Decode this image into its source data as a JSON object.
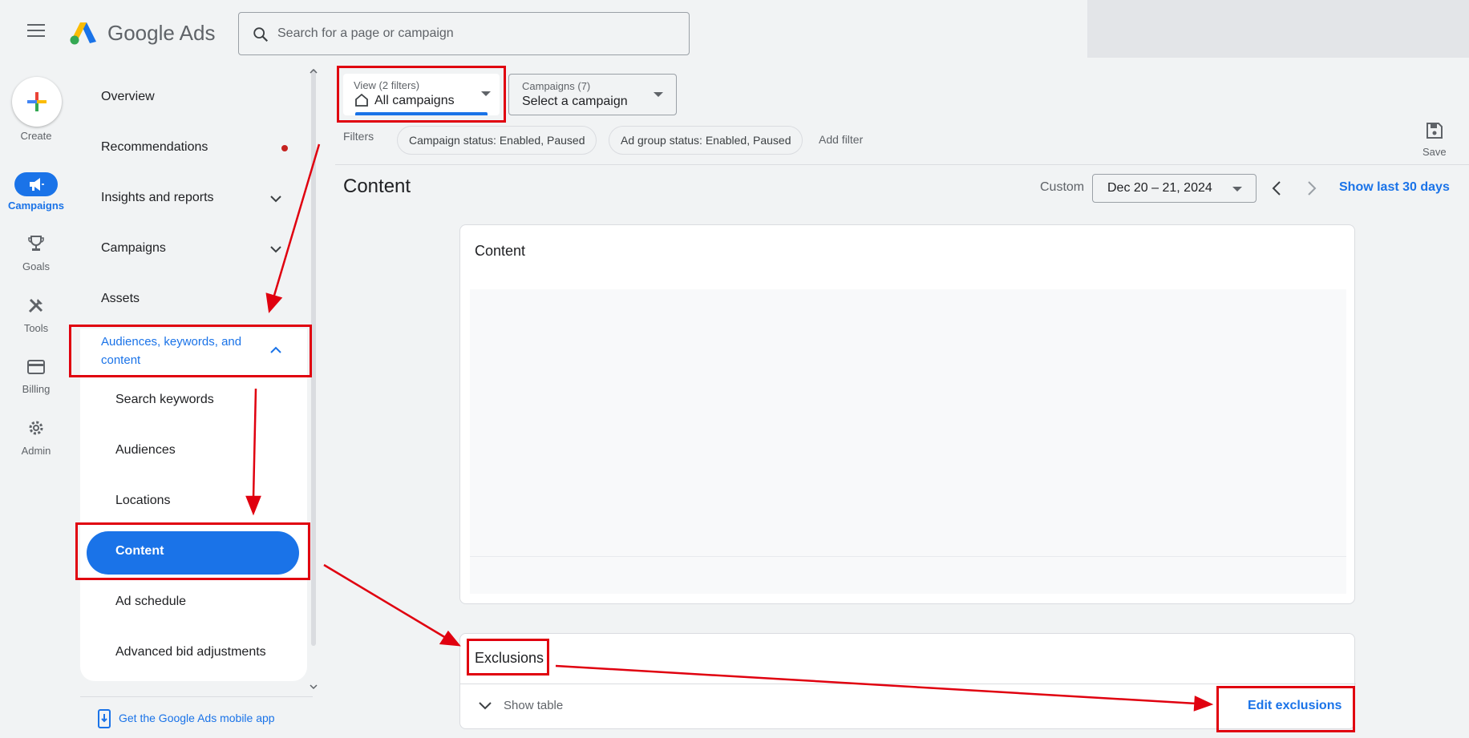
{
  "header": {
    "product_name_google": "Google",
    "product_name_ads": "Ads",
    "search_placeholder": "Search for a page or campaign"
  },
  "rail": {
    "create": "Create",
    "campaigns": "Campaigns",
    "goals": "Goals",
    "tools": "Tools",
    "billing": "Billing",
    "admin": "Admin"
  },
  "nav": {
    "overview": "Overview",
    "recommendations": "Recommendations",
    "insights": "Insights and reports",
    "campaigns": "Campaigns",
    "assets": "Assets",
    "audiences_group_line1": "Audiences, keywords, and",
    "audiences_group_line2": "content",
    "sub_items": [
      "Search keywords",
      "Audiences",
      "Locations",
      "Content",
      "Ad schedule",
      "Advanced bid adjustments"
    ],
    "mobile_app_link": "Get the Google Ads mobile app"
  },
  "filters": {
    "view_small": "View (2 filters)",
    "view_main": "All campaigns",
    "campaigns_small": "Campaigns (7)",
    "campaigns_main": "Select a campaign",
    "filters_label": "Filters",
    "chips": [
      "Campaign status: Enabled, Paused",
      "Ad group status: Enabled, Paused"
    ],
    "add_filter": "Add filter",
    "save": "Save"
  },
  "page": {
    "title": "Content",
    "custom_label": "Custom",
    "date_range": "Dec 20 – 21, 2024",
    "show_last": "Show last 30 days"
  },
  "content_card": {
    "title": "Content"
  },
  "exclusions_card": {
    "title": "Exclusions",
    "show_table": "Show table",
    "edit_exclusions": "Edit exclusions"
  },
  "colors": {
    "accent": "#1a73e8",
    "annotation": "#e0000f",
    "background": "#f1f3f4"
  }
}
